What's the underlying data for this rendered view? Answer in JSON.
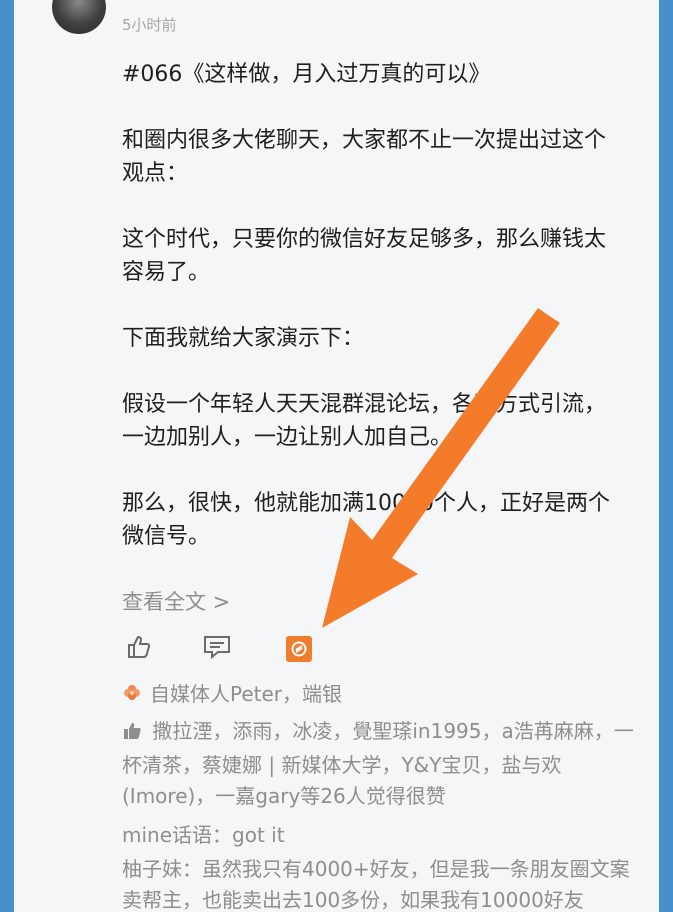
{
  "post": {
    "time": "5小时前",
    "paragraphs": [
      "#066《这样做，月入过万真的可以》",
      "和圈内很多大佬聊天，大家都不止一次提出过这个观点：",
      "这个时代，只要你的微信好友足够多，那么赚钱太容易了。",
      "下面我就给大家演示下：",
      "假设一个年轻人天天混群混论坛，各种方式引流，一边加别人，一边让别人加自己。",
      "那么，很快，他就能加满10000个人，正好是两个微信号。"
    ],
    "read_more": "查看全文 >"
  },
  "actions": {
    "like_icon": "thumbs-up-icon",
    "comment_icon": "comment-icon",
    "share_icon": "share-icon",
    "share_color": "#f07c2e"
  },
  "favorited": {
    "icon": "flower-icon",
    "text": "自媒体人Peter，端银"
  },
  "likes": {
    "icon": "thumbs-up-icon",
    "text": "撒拉湮，添雨，冰凌，覺聖瑹in1995，a浩苒麻麻，一杯清茶，蔡婕娜 | 新媒体大学，Y&Y宝贝，盐与欢(Imore)，一嘉gary等26人觉得很赞"
  },
  "comments": [
    {
      "text": "mine话语：got  it"
    },
    {
      "text": "柚子妹：虽然我只有4000+好友，但是我一条朋友圈文案卖帮主，也能卖出去100多份，如果我有10000好友"
    }
  ],
  "overlay": {
    "arrow_color": "#f47b2a"
  }
}
